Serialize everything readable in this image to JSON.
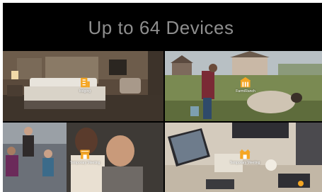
{
  "banner": {
    "title": "Up to 64 Devices",
    "accent_color": "#f5a623",
    "scenes": [
      {
        "label": "lodging",
        "icon": "hotel-icon"
      },
      {
        "label": "Farm/Ranch",
        "icon": "farm-icon"
      },
      {
        "label": "Temporary Meeting",
        "icon": "store-icon"
      },
      {
        "label": "Temporary Meeting",
        "icon": "meeting-icon"
      }
    ]
  }
}
